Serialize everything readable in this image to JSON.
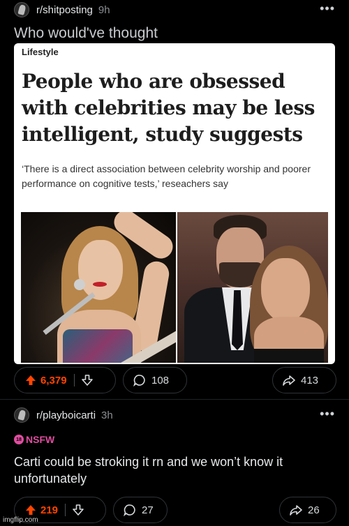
{
  "colors": {
    "upvote": "#ff4500",
    "nsfw": "#e04da0",
    "background": "#000000"
  },
  "post1": {
    "subreddit": "r/shitposting",
    "time": "9h",
    "title": "Who would've thought",
    "article": {
      "tag": "Lifestyle",
      "headline": "People who are obsessed with celebrities may be less intelligent, study suggests",
      "subheadline": "‘There is a direct association between celebrity worship and poorer performance on cognitive tests,’ reseachers say"
    },
    "votes": "6,379",
    "comments": "108",
    "shares": "413"
  },
  "post2": {
    "subreddit": "r/playboicarti",
    "time": "3h",
    "nsfw_label": "NSFW",
    "nsfw_age": "18",
    "title": "Carti could be stroking it rn and we won’t know it unfortunately",
    "votes": "219",
    "comments": "27",
    "shares": "26"
  },
  "watermark": "imgflip.com",
  "icons": [
    "subreddit-avatar-icon",
    "more-icon",
    "upvote-icon",
    "downvote-icon",
    "comment-icon",
    "share-icon"
  ]
}
